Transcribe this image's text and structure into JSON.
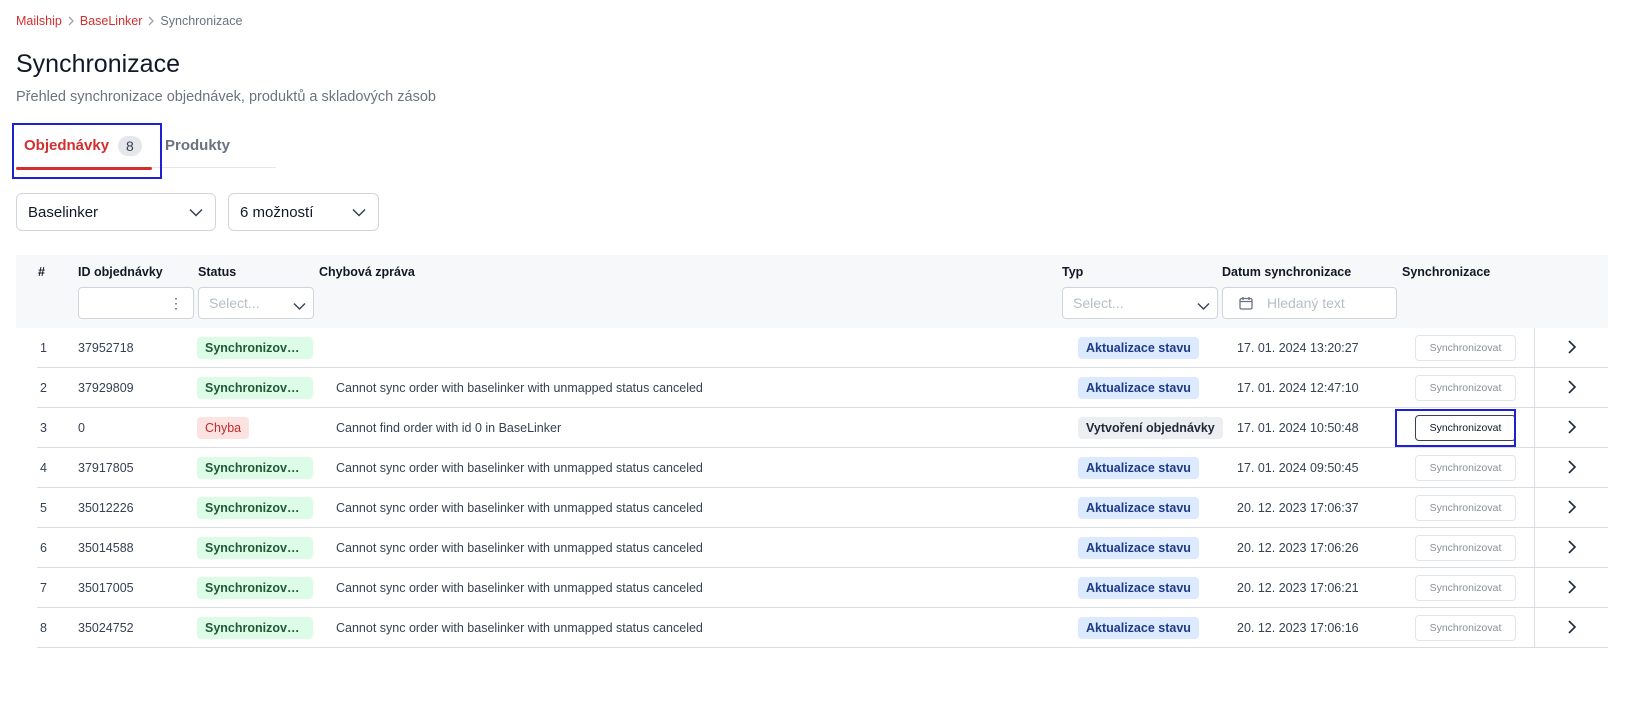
{
  "breadcrumb": {
    "items": [
      "Mailship",
      "BaseLinker"
    ],
    "current": "Synchronizace"
  },
  "page": {
    "title": "Synchronizace",
    "subtitle": "Přehled synchronizace objednávek, produktů a skladových zásob"
  },
  "tabs": [
    {
      "label": "Objednávky",
      "count": "8",
      "active": true
    },
    {
      "label": "Produkty",
      "active": false
    }
  ],
  "filters": {
    "integration": "Baselinker",
    "options": "6 možností"
  },
  "table": {
    "headers": {
      "num": "#",
      "order_id": "ID objednávky",
      "status": "Status",
      "error": "Chybová zpráva",
      "type": "Typ",
      "date": "Datum synchronizace",
      "sync": "Synchronizace"
    },
    "header_inputs": {
      "status_placeholder": "Select...",
      "type_placeholder": "Select...",
      "date_placeholder": "Hledaný text"
    },
    "sync_button_label": "Synchronizovat",
    "rows": [
      {
        "num": "1",
        "id": "37952718",
        "status": "Synchronizováno",
        "status_kind": "ok",
        "error": "",
        "type": "Aktualizace stavu",
        "type_kind": "upd",
        "date": "17. 01. 2024 13:20:27"
      },
      {
        "num": "2",
        "id": "37929809",
        "status": "Synchronizováno",
        "status_kind": "ok",
        "error": "Cannot sync order with baselinker with unmapped status canceled",
        "type": "Aktualizace stavu",
        "type_kind": "upd",
        "date": "17. 01. 2024 12:47:10"
      },
      {
        "num": "3",
        "id": "0",
        "status": "Chyba",
        "status_kind": "err",
        "error": "Cannot find order with id 0 in BaseLinker",
        "type": "Vytvoření objednávky",
        "type_kind": "create",
        "date": "17. 01. 2024 10:50:48"
      },
      {
        "num": "4",
        "id": "37917805",
        "status": "Synchronizováno",
        "status_kind": "ok",
        "error": "Cannot sync order with baselinker with unmapped status canceled",
        "type": "Aktualizace stavu",
        "type_kind": "upd",
        "date": "17. 01. 2024 09:50:45"
      },
      {
        "num": "5",
        "id": "35012226",
        "status": "Synchronizováno",
        "status_kind": "ok",
        "error": "Cannot sync order with baselinker with unmapped status canceled",
        "type": "Aktualizace stavu",
        "type_kind": "upd",
        "date": "20. 12. 2023 17:06:37"
      },
      {
        "num": "6",
        "id": "35014588",
        "status": "Synchronizováno",
        "status_kind": "ok",
        "error": "Cannot sync order with baselinker with unmapped status canceled",
        "type": "Aktualizace stavu",
        "type_kind": "upd",
        "date": "20. 12. 2023 17:06:26"
      },
      {
        "num": "7",
        "id": "35017005",
        "status": "Synchronizováno",
        "status_kind": "ok",
        "error": "Cannot sync order with baselinker with unmapped status canceled",
        "type": "Aktualizace stavu",
        "type_kind": "upd",
        "date": "20. 12. 2023 17:06:21"
      },
      {
        "num": "8",
        "id": "35024752",
        "status": "Synchronizováno",
        "status_kind": "ok",
        "error": "Cannot sync order with baselinker with unmapped status canceled",
        "type": "Aktualizace stavu",
        "type_kind": "upd",
        "date": "20. 12. 2023 17:06:16"
      }
    ]
  },
  "icons": {
    "breadcrumb_separator": "chevron-right-icon",
    "dropdown": "chevron-down-icon",
    "row_action": "chevron-right-icon",
    "date": "calendar-icon",
    "column_menu": "kebab-menu-icon"
  }
}
